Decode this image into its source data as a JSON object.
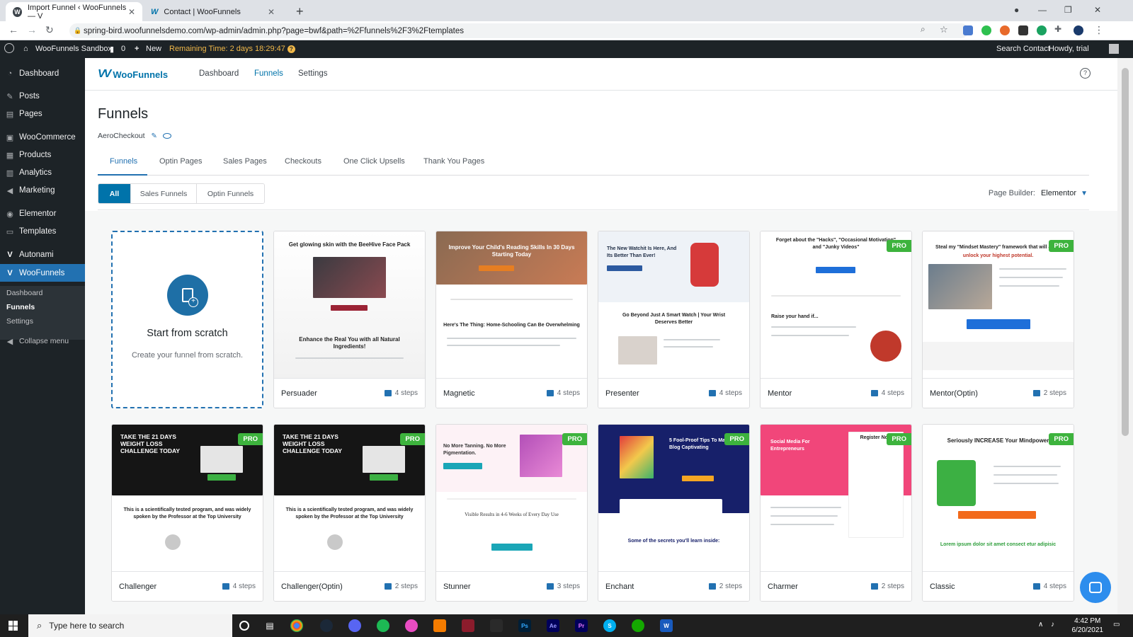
{
  "browser": {
    "tabs": [
      {
        "title": "Import Funnel ‹ WooFunnels — V"
      },
      {
        "title": "Contact | WooFunnels"
      }
    ],
    "url": "spring-bird.woofunnelsdemo.com/wp-admin/admin.php?page=bwf&path=%2Ffunnels%2F3%2Ftemplates"
  },
  "adminbar": {
    "site": "WooFunnels Sandbox",
    "comments": "0",
    "new": "New",
    "remaining": "Remaining Time: 2 days 18:29:47",
    "search": "Search Contact",
    "howdy": "Howdy, trial"
  },
  "sidebar": {
    "items": [
      {
        "label": "Dashboard",
        "icon": "dashboard-icon"
      },
      {
        "label": "Posts",
        "icon": "pin-icon"
      },
      {
        "label": "Pages",
        "icon": "pages-icon"
      },
      {
        "label": "WooCommerce",
        "icon": "woo-icon"
      },
      {
        "label": "Products",
        "icon": "archive-icon"
      },
      {
        "label": "Analytics",
        "icon": "chart-icon"
      },
      {
        "label": "Marketing",
        "icon": "megaphone-icon"
      },
      {
        "label": "Elementor",
        "icon": "elementor-icon"
      },
      {
        "label": "Templates",
        "icon": "folder-icon"
      },
      {
        "label": "Autonami",
        "icon": "autonami-icon"
      },
      {
        "label": "WooFunnels",
        "icon": "woofunnels-icon"
      }
    ],
    "sub": [
      "Dashboard",
      "Funnels",
      "Settings"
    ],
    "collapse": "Collapse menu"
  },
  "wfheader": {
    "brand": "WooFunnels",
    "nav": [
      "Dashboard",
      "Funnels",
      "Settings"
    ]
  },
  "page": {
    "title": "Funnels",
    "funnel_name": "AeroCheckout",
    "tabs": [
      "Funnels",
      "Optin Pages",
      "Sales Pages",
      "Checkouts",
      "One Click Upsells",
      "Thank You Pages"
    ],
    "filters": [
      "All",
      "Sales Funnels",
      "Optin Funnels"
    ],
    "page_builder_label": "Page Builder:",
    "page_builder_value": "Elementor"
  },
  "scratch": {
    "title": "Start from scratch",
    "subtitle": "Create your funnel from scratch."
  },
  "pro_label": "PRO",
  "templates": [
    {
      "name": "Persuader",
      "steps": "4 steps",
      "pro": false,
      "h1": "Get glowing skin with the BeeHive Face Pack",
      "h2": "Enhance the Real You with all Natural Ingredients!"
    },
    {
      "name": "Magnetic",
      "steps": "4 steps",
      "pro": false,
      "h1": "Improve Your Child's Reading Skills In 30 Days Starting Today",
      "h2": "Here's The Thing: Home-Schooling Can Be Overwhelming"
    },
    {
      "name": "Presenter",
      "steps": "4 steps",
      "pro": false,
      "h1": "The New Watchit Is Here, And Its Better Than Ever!",
      "h2": "Go Beyond Just A Smart Watch | Your Wrist Deserves Better"
    },
    {
      "name": "Mentor",
      "steps": "4 steps",
      "pro": true,
      "h1": "Forget about the \"Hacks\", \"Occasional Motivation\" and \"Junky Videos\"",
      "h2": "Raise your hand if..."
    },
    {
      "name": "Mentor(Optin)",
      "steps": "2 steps",
      "pro": true,
      "h1": "Steal my \"Mindset Mastery\" framework that will allow",
      "h2": "unlock your highest potential."
    },
    {
      "name": "Challenger",
      "steps": "4 steps",
      "pro": true,
      "h1": "TAKE THE 21 DAYS WEIGHT LOSS CHALLENGE TODAY",
      "h2": "This is a scientifically tested program, and was widely spoken by the Professor at the Top University"
    },
    {
      "name": "Challenger(Optin)",
      "steps": "2 steps",
      "pro": true,
      "h1": "TAKE THE 21 DAYS WEIGHT LOSS CHALLENGE TODAY",
      "h2": "This is a scientifically tested program, and was widely spoken by the Professor at the Top University"
    },
    {
      "name": "Stunner",
      "steps": "3 steps",
      "pro": true,
      "h1": "No More Tanning. No More Pigmentation.",
      "h2": "Visible Results in 4-6 Weeks of Every Day Use"
    },
    {
      "name": "Enchant",
      "steps": "2 steps",
      "pro": true,
      "h1": "5 Fool-Proof Tips To Make Any Blog Captivating",
      "h2": "Some of the secrets you'll learn inside:"
    },
    {
      "name": "Charmer",
      "steps": "2 steps",
      "pro": true,
      "h1": "Social Media For Entrepreneurs",
      "h2": "Register Now"
    },
    {
      "name": "Classic",
      "steps": "4 steps",
      "pro": true,
      "h1": "Seriously INCREASE Your Mindpower",
      "h2": "Lorem ipsum dolor sit amet consect etur adipisic"
    }
  ],
  "taskbar": {
    "search_placeholder": "Type here to search",
    "time": "4:42 PM",
    "date": "6/20/2021"
  }
}
